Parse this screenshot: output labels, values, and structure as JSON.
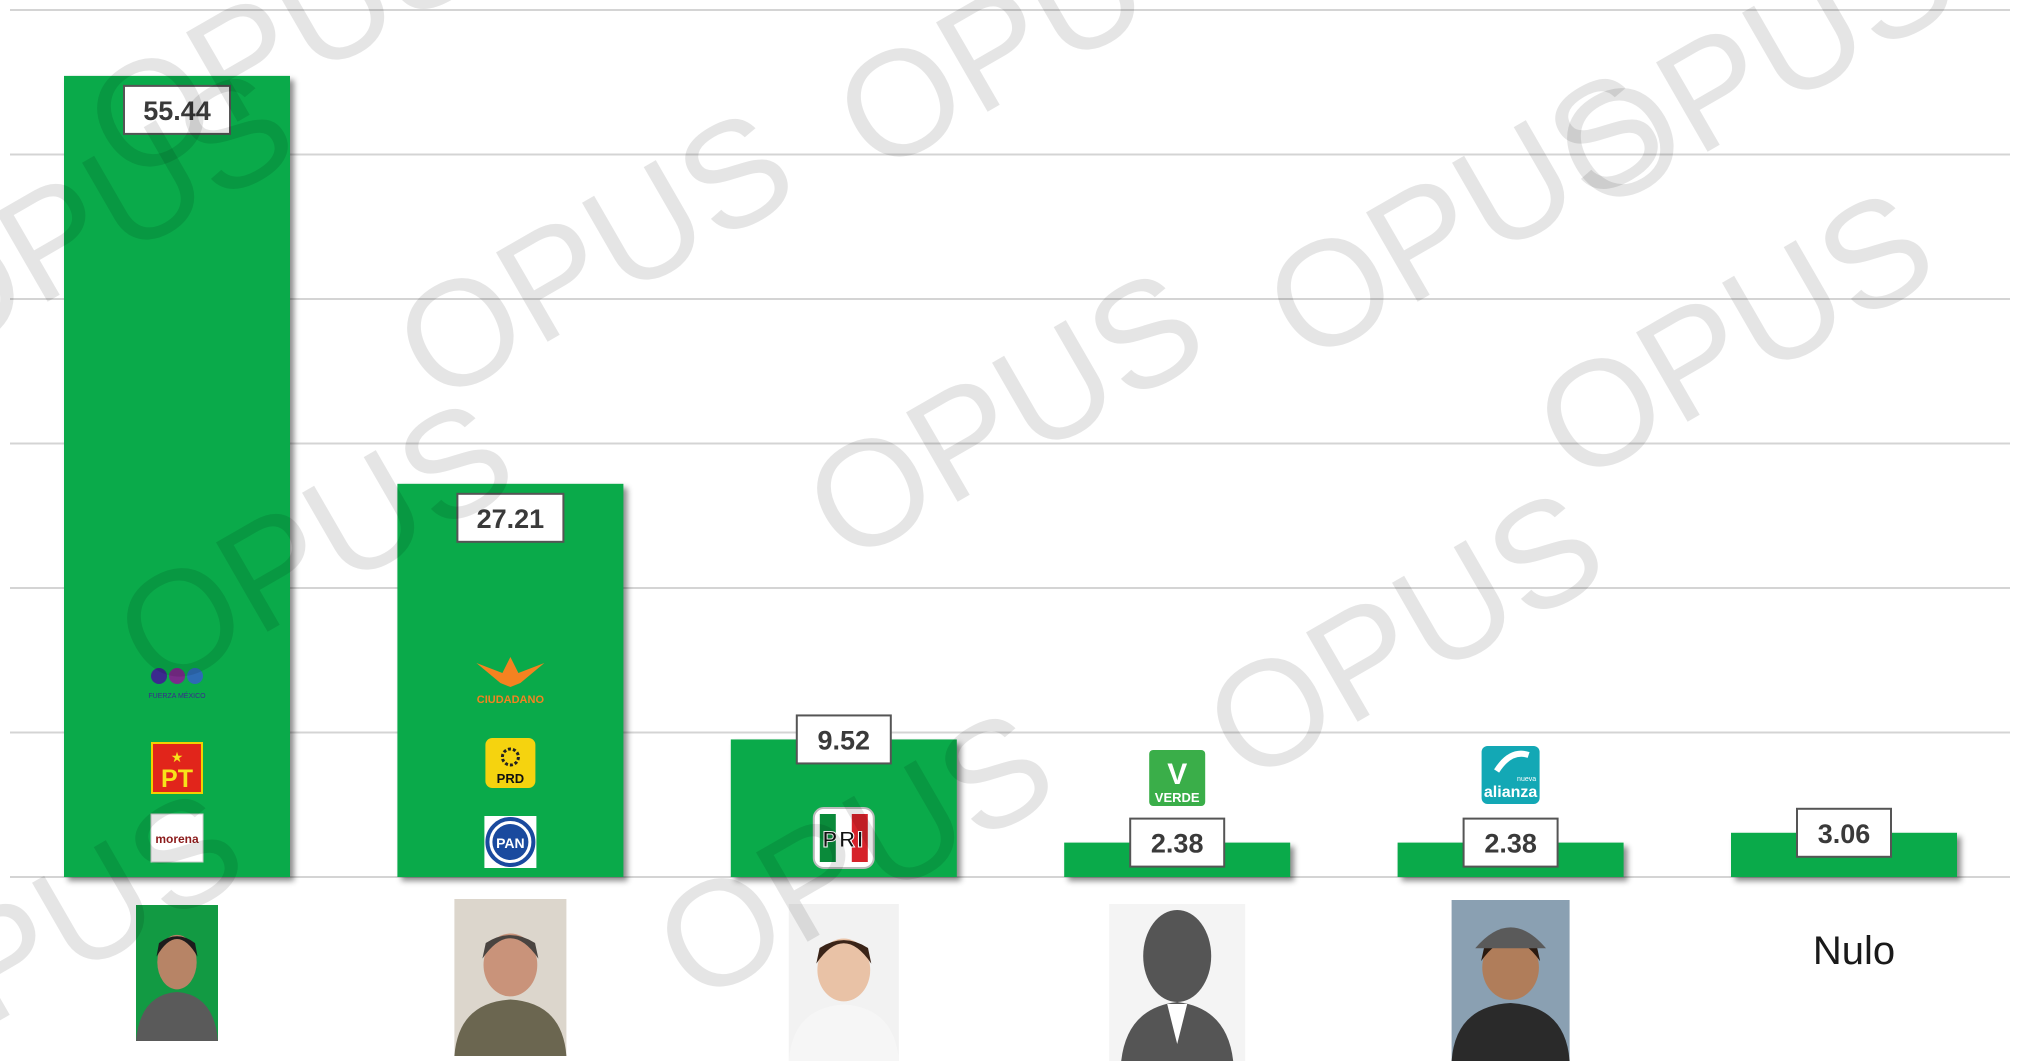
{
  "watermark_text": "OPUS",
  "colors": {
    "bar": "#0aaa4a",
    "grid": "#d4d4d4",
    "label_border": "#555555",
    "label_bg": "#ffffff",
    "label_text": "#3a3a3a",
    "watermark": "#000000"
  },
  "chart_data": {
    "type": "bar",
    "title": "",
    "xlabel": "",
    "ylabel": "",
    "ylim": [
      0,
      60
    ],
    "grid": true,
    "categories": [
      "",
      "",
      "",
      "",
      "",
      "Nulo"
    ],
    "values": [
      55.44,
      27.21,
      9.52,
      2.38,
      2.38,
      3.06
    ],
    "value_labels": [
      "55.44",
      "27.21",
      "9.52",
      "2.38",
      "2.38",
      "3.06"
    ],
    "party_logos": [
      [
        "morena-logo",
        "pt-logo",
        "fuerza-mexico-logo"
      ],
      [
        "pan-logo",
        "prd-logo",
        "movimiento-ciudadano-logo"
      ],
      [
        "pri-logo"
      ],
      [
        "verde-logo"
      ],
      [
        "nueva-alianza-logo"
      ],
      []
    ],
    "candidate_images": [
      "candidate-photo-man",
      "candidate-photo-man",
      "candidate-photo-woman",
      "silhouette-woman-icon",
      "candidate-photo-man-cap",
      ""
    ]
  },
  "logo_text": {
    "morena": "morena",
    "pt": "PT",
    "prd": "PRD",
    "pan": "PAN",
    "pri": "PRI",
    "verde": "VERDE",
    "nueva_alianza": "alianza",
    "nueva": "nueva",
    "ciudadano": "CIUDADANO",
    "fuerza": "FUERZA MÉXICO"
  }
}
